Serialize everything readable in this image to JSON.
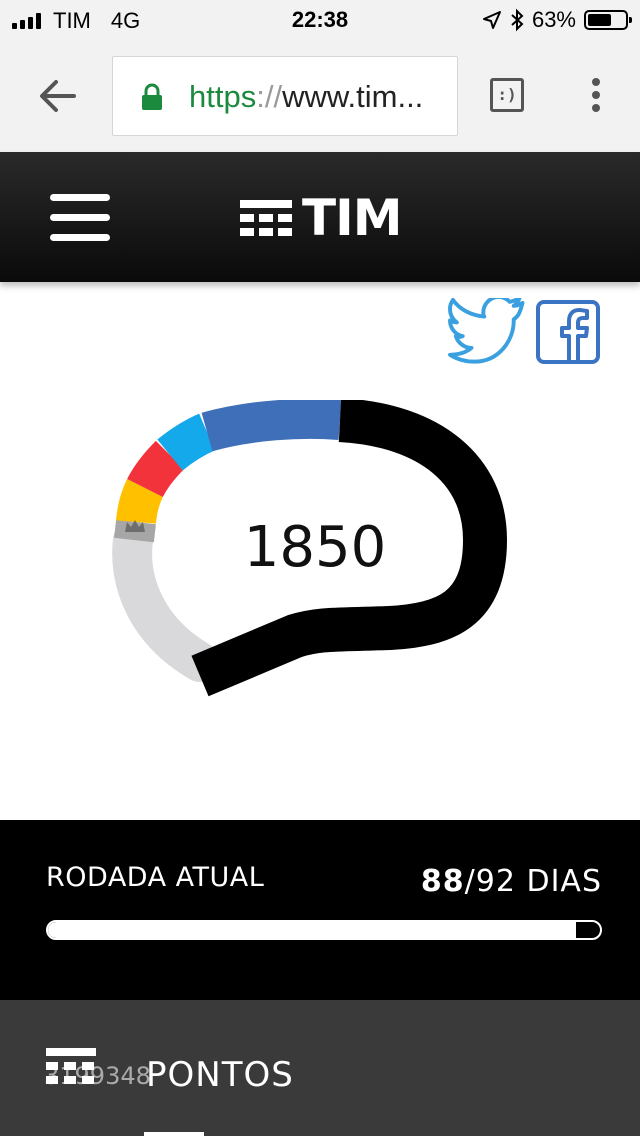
{
  "status_bar": {
    "carrier": "TIM",
    "network": "4G",
    "time": "22:38",
    "battery": "63%",
    "battery_level": 0.63
  },
  "browser": {
    "url_protocol": "https",
    "url_separator": "://",
    "url_rest": "www.tim..."
  },
  "app": {
    "logo_text": "TIM"
  },
  "gauge": {
    "points": "1850",
    "segments": [
      {
        "color": "#d9d9dc"
      },
      {
        "color": "#a6a6a6"
      },
      {
        "color": "#ffc000"
      },
      {
        "color": "#f2333b"
      },
      {
        "color": "#14a9ea"
      },
      {
        "color": "#3f6fb9"
      },
      {
        "color": "#000000"
      }
    ]
  },
  "round": {
    "label": "RODADA ATUAL",
    "days_current": "88",
    "days_total": "/92 DIAS",
    "progress": 0.9565
  },
  "bottom": {
    "number": "3199348",
    "label": "PONTOS"
  },
  "colors": {
    "twitter": "#3aa0e0",
    "facebook": "#3b74c2",
    "header_bg": "#111111",
    "url_green": "#1b8a3d"
  }
}
